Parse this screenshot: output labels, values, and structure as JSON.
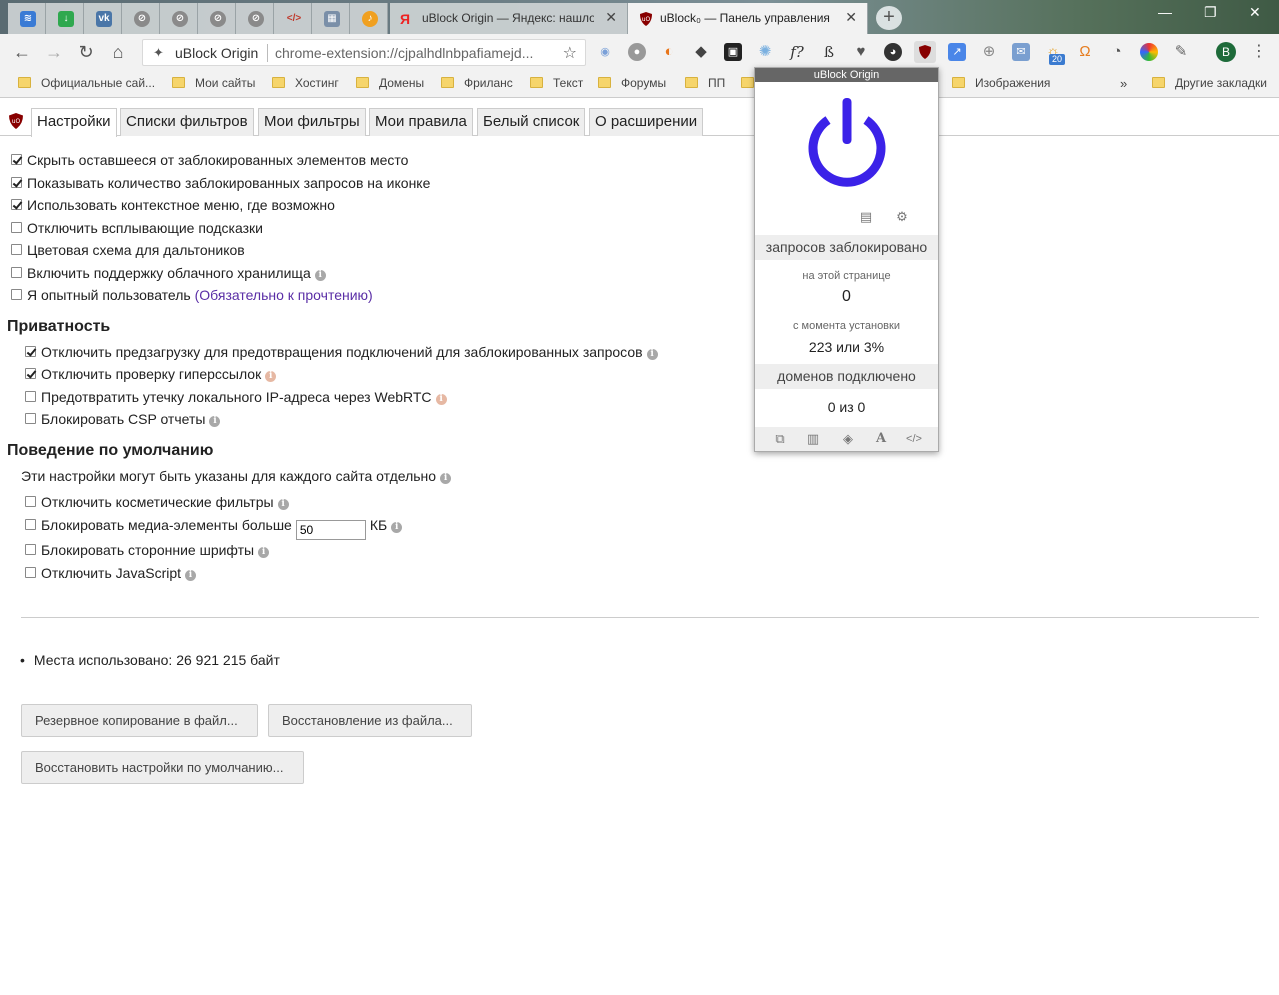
{
  "browser": {
    "tabs": [
      {
        "title": "uBlock Origin — Яндекс: нашло",
        "active": false
      },
      {
        "title": "uBlock₀ — Панель управления",
        "active": true
      }
    ],
    "omnibox": {
      "site": "uBlock Origin",
      "url": "chrome-extension://cjpalhdlnbpafiamejd..."
    },
    "profile_initial": "B",
    "ext_badge": "20",
    "bookmarks": [
      "Официальные сай...",
      "Мои сайты",
      "Хостинг",
      "Домены",
      "Фриланс",
      "Текст",
      "Форумы",
      "ПП",
      "Изображения",
      "Другие закладки"
    ],
    "bookmarks_more": "»"
  },
  "dashboard": {
    "tabs": [
      "Настройки",
      "Списки фильтров",
      "Мои фильтры",
      "Мои правила",
      "Белый список",
      "О расширении"
    ],
    "general": [
      {
        "label": "Скрыть оставшееся от заблокированных элементов место",
        "checked": true
      },
      {
        "label": "Показывать количество заблокированных запросов на иконке",
        "checked": true
      },
      {
        "label": "Использовать контекстное меню, где возможно",
        "checked": true
      },
      {
        "label": "Отключить всплывающие подсказки",
        "checked": false
      },
      {
        "label": "Цветовая схема для дальтоников",
        "checked": false
      },
      {
        "label": "Включить поддержку облачного хранилища",
        "checked": false
      },
      {
        "label": "Я опытный пользователь",
        "checked": false
      }
    ],
    "advanced_link": "(Обязательно к прочтению)",
    "privacy_heading": "Приватность",
    "privacy": [
      {
        "label": "Отключить предзагрузку для предотвращения подключений для заблокированных запросов",
        "checked": true
      },
      {
        "label": "Отключить проверку гиперссылок",
        "checked": true
      },
      {
        "label": "Предотвратить утечку локального IP-адреса через WebRTC",
        "checked": false
      },
      {
        "label": "Блокировать CSP отчеты",
        "checked": false
      }
    ],
    "default_heading": "Поведение по умолчанию",
    "default_note": "Эти настройки могут быть указаны для каждого сайта отдельно",
    "defaults": [
      {
        "label": "Отключить косметические фильтры",
        "checked": false
      },
      {
        "label": "Блокировать медиа-элементы больше",
        "checked": false
      },
      {
        "label": "Блокировать сторонние шрифты",
        "checked": false
      },
      {
        "label": "Отключить JavaScript",
        "checked": false
      }
    ],
    "media_size": "50",
    "media_unit": "КБ",
    "storage": "Места использовано: 26 921 215 байт",
    "buttons": {
      "backup": "Резервное копирование в файл...",
      "restore": "Восстановление из файла...",
      "reset": "Восстановить настройки по умолчанию..."
    }
  },
  "popup": {
    "title": "uBlock Origin",
    "blocked_header": "запросов заблокировано",
    "on_page_label": "на этой странице",
    "on_page_value": "0",
    "since_install_label": "с момента установки",
    "since_install_value": "223 или 3%",
    "domains_header": "доменов подключено",
    "domains_value": "0 из 0",
    "power_color": "#3b22e8"
  }
}
